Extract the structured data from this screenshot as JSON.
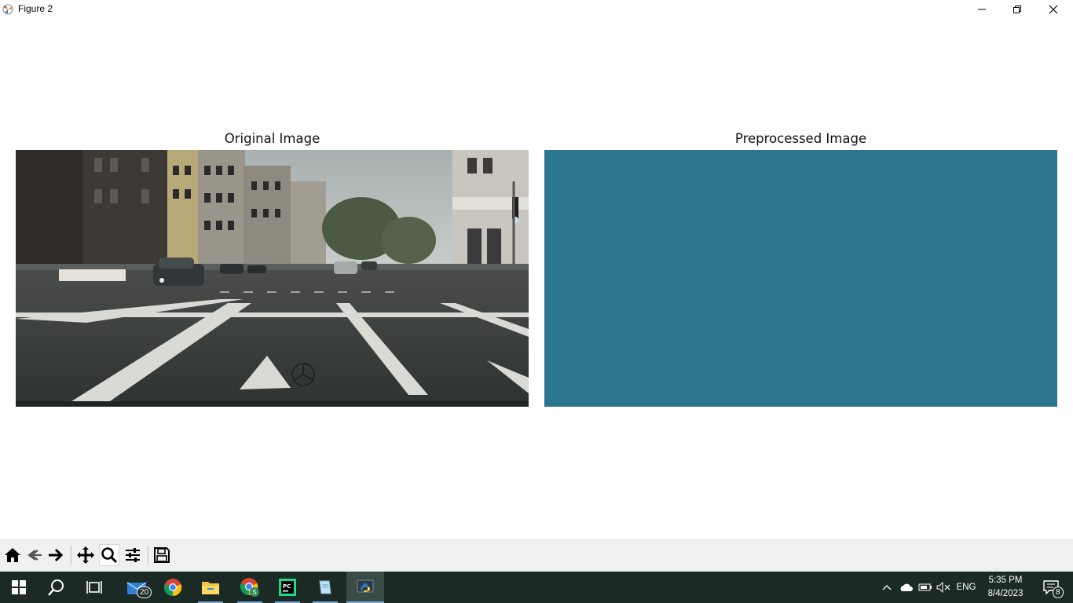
{
  "window": {
    "title": "Figure 2"
  },
  "figure": {
    "axes": [
      {
        "title": "Original Image"
      },
      {
        "title": "Preprocessed Image",
        "fill_color": "#2b758e"
      }
    ]
  },
  "toolbar": {
    "buttons": [
      "home-icon",
      "back-icon",
      "forward-icon",
      "pan-icon",
      "zoom-icon",
      "configure-subplots-icon",
      "save-icon"
    ],
    "active": "zoom-icon"
  },
  "taskbar": {
    "apps": [
      "start-icon",
      "search-icon",
      "task-view-icon",
      "mail-icon",
      "chrome-icon",
      "file-explorer-icon",
      "chrome-profile-icon",
      "pycharm-icon",
      "notepad-icon",
      "python-icon"
    ],
    "mail_badge": "20",
    "tray": {
      "language": "ENG",
      "time": "5:35 PM",
      "date": "8/4/2023",
      "notification_count": "8"
    }
  }
}
